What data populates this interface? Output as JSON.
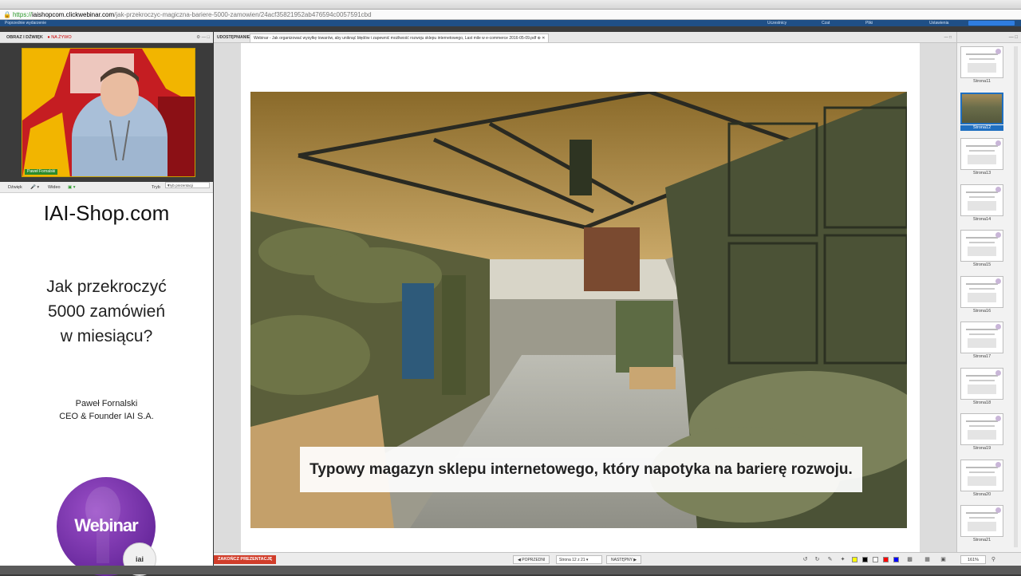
{
  "browser": {
    "url_scheme": "https://",
    "url_domain": "iaishopcom.clickwebinar.com",
    "url_path": "/jak-przekroczyc-magiczna-bariere-5000-zamowien/24acf35821952ab476594c0057591cbd"
  },
  "app_bar": {
    "left_item": "Poprzednie wydarzenie",
    "right_items": [
      "Uczestnicy",
      "Czat",
      "Pliki",
      "Ustawienia"
    ]
  },
  "video_panel": {
    "header": "OBRAZ I DŹWIĘK",
    "live": "NA ŻYWO",
    "presenter_name": "Paweł Fornalski",
    "sound_label": "Dźwięk",
    "video_label": "Wideo",
    "mode_label": "Tryb",
    "mode_value": "Tryb prezentacji"
  },
  "left_slide": {
    "title": "IAI-Shop.com",
    "question_line1": "Jak przekroczyć",
    "question_line2": "5000 zamówień",
    "question_line3": "w miesiącu?",
    "author_name": "Paweł Fornalski",
    "author_role": "CEO & Founder IAI S.A.",
    "badge_text": "Webinar",
    "logo_text": "iai"
  },
  "share": {
    "tab_label": "UDOSTĘPNIANIE",
    "doc_title": "Webinar - Jak organizować wysyłkę towarów, aby uniknąć błędów i zapewnić możliwość rozwoju sklepu internetowego, Last mile w e-commerce 2016-05-09.pdf"
  },
  "slide": {
    "caption": "Typowy magazyn sklepu internetowego, który napotyka na barierę rozwoju."
  },
  "thumbnails": {
    "items": [
      {
        "label": "Strona11",
        "active": false
      },
      {
        "label": "Strona12",
        "active": true
      },
      {
        "label": "Strona13",
        "active": false
      },
      {
        "label": "Strona14",
        "active": false
      },
      {
        "label": "Strona15",
        "active": false
      },
      {
        "label": "Strona16",
        "active": false
      },
      {
        "label": "Strona17",
        "active": false
      },
      {
        "label": "Strona18",
        "active": false
      },
      {
        "label": "Strona19",
        "active": false
      },
      {
        "label": "Strona20",
        "active": false
      },
      {
        "label": "Strona21",
        "active": false
      }
    ]
  },
  "bottom": {
    "end_label": "ZAKOŃCZ PREZENTACJĘ",
    "prev_label": "POPRZEDNI",
    "page_value": "Strona 12 z 21",
    "next_label": "NASTĘPNY",
    "zoom_value": "161%",
    "colors": [
      "#ffff00",
      "#000000",
      "#ffffff",
      "#ff0000",
      "#0000ff"
    ]
  }
}
